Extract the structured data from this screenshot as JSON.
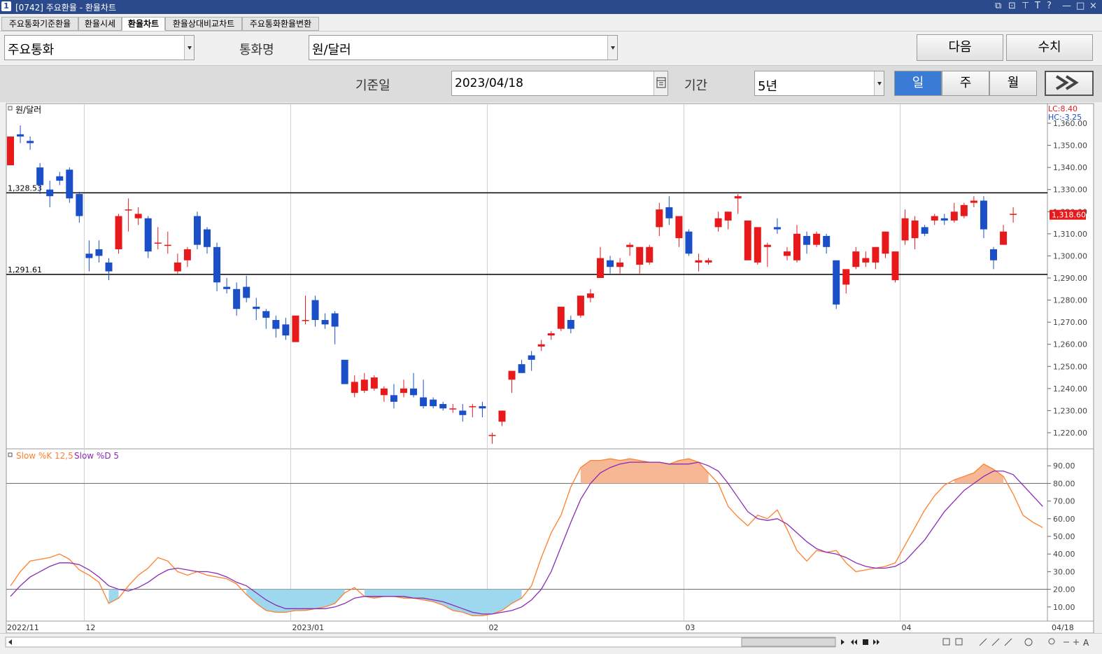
{
  "window": {
    "num": "1",
    "title": "[0742] 주요환율 - 환율차트",
    "controls": [
      "⧉",
      "⊡",
      "⊤",
      "T",
      "?",
      "—",
      "□",
      "×"
    ]
  },
  "tabs": [
    {
      "label": "주요통화기준환율",
      "active": false
    },
    {
      "label": "환율시세",
      "active": false
    },
    {
      "label": "환율차트",
      "active": true
    },
    {
      "label": "환율상대비교차트",
      "active": false
    },
    {
      "label": "주요통화환율변환",
      "active": false
    }
  ],
  "toolbar": {
    "group_value": "주요통화",
    "currency_label": "통화명",
    "currency_value": "원/달러",
    "next_label": "다음",
    "value_label": "수치"
  },
  "filter": {
    "date_label": "기준일",
    "date_value": "2023/04/18",
    "period_label": "기간",
    "period_value": "5년",
    "periods": [
      {
        "label": "일",
        "active": true
      },
      {
        "label": "주",
        "active": false
      },
      {
        "label": "월",
        "active": false
      }
    ],
    "expand_icon": "double-chevron-right-icon"
  },
  "colors": {
    "up": "#e8191b",
    "down": "#1a4fc8",
    "k_line": "#ff7f2a",
    "d_line": "#8a2bb5",
    "overbought_fill": "#f6b894",
    "oversold_fill": "#9dd8ef"
  },
  "chart_data": [
    {
      "type": "candlestick",
      "title": "원/달러",
      "legend_extra": [
        "LC:8.40",
        "HC:-3.25"
      ],
      "ylim": [
        1215,
        1360
      ],
      "yticks": [
        "1,360.00",
        "1,350.00",
        "1,340.00",
        "1,330.00",
        "1,320.00",
        "1,310.00",
        "1,300.00",
        "1,290.00",
        "1,280.00",
        "1,270.00",
        "1,260.00",
        "1,250.00",
        "1,240.00",
        "1,230.00",
        "1,220.00"
      ],
      "hlines": [
        {
          "value": 1328.53,
          "label": "1,328.53"
        },
        {
          "value": 1291.61,
          "label": "1,291.61"
        }
      ],
      "last_price_label": "1,318.60",
      "x_labels": [
        {
          "label": "2022/11",
          "index": 0
        },
        {
          "label": "12",
          "index": 8
        },
        {
          "label": "2023/01",
          "index": 29
        },
        {
          "label": "02",
          "index": 49
        },
        {
          "label": "03",
          "index": 69
        },
        {
          "label": "04",
          "index": 91
        },
        {
          "label": "04/18",
          "index": 103
        }
      ],
      "candles": [
        [
          1341,
          1354,
          1342,
          1354
        ],
        [
          1355,
          1359,
          1351,
          1354
        ],
        [
          1352,
          1354,
          1348,
          1351
        ],
        [
          1340,
          1342,
          1328,
          1332
        ],
        [
          1330,
          1334,
          1322,
          1327
        ],
        [
          1336,
          1338,
          1332,
          1334
        ],
        [
          1339,
          1340,
          1324,
          1326
        ],
        [
          1328,
          1329,
          1315,
          1318
        ],
        [
          1301,
          1307,
          1293,
          1299
        ],
        [
          1303,
          1307,
          1297,
          1300
        ],
        [
          1297,
          1299,
          1289,
          1293
        ],
        [
          1303,
          1319,
          1301,
          1318
        ],
        [
          1321,
          1326,
          1311,
          1321
        ],
        [
          1317,
          1322,
          1314,
          1319
        ],
        [
          1317,
          1318,
          1299,
          1302
        ],
        [
          1306,
          1313,
          1303,
          1306
        ],
        [
          1305,
          1311,
          1301,
          1305
        ],
        [
          1293,
          1301,
          1292,
          1297
        ],
        [
          1298,
          1304,
          1295,
          1303
        ],
        [
          1318,
          1320,
          1303,
          1305
        ],
        [
          1312,
          1313,
          1301,
          1304
        ],
        [
          1304,
          1306,
          1284,
          1288
        ],
        [
          1286,
          1290,
          1283,
          1285
        ],
        [
          1285,
          1288,
          1273,
          1276
        ],
        [
          1286,
          1291,
          1279,
          1281
        ],
        [
          1277,
          1281,
          1271,
          1276
        ],
        [
          1275,
          1276,
          1267,
          1272
        ],
        [
          1271,
          1273,
          1263,
          1267
        ],
        [
          1269,
          1272,
          1262,
          1264
        ],
        [
          1261,
          1273,
          1261,
          1273
        ],
        [
          1271,
          1282,
          1269,
          1271
        ],
        [
          1280,
          1282,
          1268,
          1271
        ],
        [
          1271,
          1274,
          1267,
          1269
        ],
        [
          1274,
          1275,
          1260,
          1268
        ],
        [
          1253,
          1253,
          1242,
          1242
        ],
        [
          1238,
          1246,
          1236,
          1243
        ],
        [
          1239,
          1247,
          1238,
          1244
        ],
        [
          1240,
          1246,
          1239,
          1245
        ],
        [
          1237,
          1241,
          1234,
          1240
        ],
        [
          1237,
          1242,
          1231,
          1234
        ],
        [
          1238,
          1244,
          1236,
          1240
        ],
        [
          1240,
          1247,
          1236,
          1237
        ],
        [
          1236,
          1244,
          1231,
          1232
        ],
        [
          1235,
          1236,
          1231,
          1232
        ],
        [
          1233,
          1234,
          1230,
          1231
        ],
        [
          1231,
          1233,
          1229,
          1231
        ],
        [
          1230,
          1233,
          1225,
          1228
        ],
        [
          1232,
          1233,
          1227,
          1232
        ],
        [
          1232,
          1234,
          1227,
          1231
        ],
        [
          1219,
          1220,
          1215,
          1219
        ],
        [
          1225,
          1230,
          1223,
          1230
        ],
        [
          1244,
          1245,
          1238,
          1248
        ],
        [
          1251,
          1253,
          1247,
          1247
        ],
        [
          1255,
          1257,
          1248,
          1253
        ],
        [
          1259,
          1262,
          1257,
          1260
        ],
        [
          1264,
          1266,
          1262,
          1265
        ],
        [
          1267,
          1277,
          1266,
          1277
        ],
        [
          1271,
          1273,
          1265,
          1267
        ],
        [
          1273,
          1282,
          1272,
          1282
        ],
        [
          1281,
          1285,
          1279,
          1283
        ],
        [
          1290,
          1304,
          1290,
          1299
        ],
        [
          1298,
          1300,
          1292,
          1295
        ],
        [
          1295,
          1299,
          1292,
          1297
        ],
        [
          1304,
          1306,
          1300,
          1305
        ],
        [
          1296,
          1303,
          1292,
          1304
        ],
        [
          1297,
          1305,
          1296,
          1304
        ],
        [
          1313,
          1324,
          1309,
          1321
        ],
        [
          1322,
          1327,
          1314,
          1317
        ],
        [
          1308,
          1315,
          1304,
          1318
        ],
        [
          1311,
          1312,
          1300,
          1301
        ],
        [
          1297,
          1301,
          1293,
          1298
        ],
        [
          1297,
          1299,
          1296,
          1298
        ],
        [
          1313,
          1320,
          1311,
          1317
        ],
        [
          1316,
          1317,
          1312,
          1320
        ],
        [
          1326,
          1328,
          1319,
          1327
        ],
        [
          1298,
          1316,
          1298,
          1316
        ],
        [
          1297,
          1313,
          1296,
          1313
        ],
        [
          1304,
          1306,
          1295,
          1305
        ],
        [
          1313,
          1317,
          1310,
          1312
        ],
        [
          1300,
          1304,
          1298,
          1302
        ],
        [
          1298,
          1314,
          1297,
          1310
        ],
        [
          1309,
          1311,
          1301,
          1305
        ],
        [
          1305,
          1311,
          1304,
          1310
        ],
        [
          1309,
          1310,
          1301,
          1304
        ],
        [
          1298,
          1298,
          1276,
          1278
        ],
        [
          1287,
          1294,
          1283,
          1294
        ],
        [
          1295,
          1304,
          1294,
          1302
        ],
        [
          1297,
          1302,
          1295,
          1299
        ],
        [
          1297,
          1304,
          1294,
          1304
        ],
        [
          1301,
          1311,
          1299,
          1311
        ],
        [
          1289,
          1301,
          1288,
          1302
        ],
        [
          1307,
          1321,
          1305,
          1317
        ],
        [
          1308,
          1318,
          1303,
          1316
        ],
        [
          1313,
          1314,
          1309,
          1310
        ],
        [
          1316,
          1319,
          1314,
          1318
        ],
        [
          1317,
          1319,
          1314,
          1316
        ],
        [
          1316,
          1324,
          1315,
          1320
        ],
        [
          1318,
          1324,
          1317,
          1323
        ],
        [
          1324,
          1327,
          1322,
          1325
        ],
        [
          1325,
          1327,
          1308,
          1312
        ],
        [
          1303,
          1304,
          1294,
          1298
        ],
        [
          1305,
          1314,
          1305,
          1311
        ],
        [
          1319,
          1322,
          1315,
          1319
        ]
      ]
    },
    {
      "type": "line",
      "legend": [
        {
          "name": "Slow %K 12,5",
          "color": "#ff7f2a"
        },
        {
          "name": "Slow %D 5",
          "color": "#8a2bb5"
        }
      ],
      "ylim": [
        0,
        100
      ],
      "yticks": [
        "90.00",
        "80.00",
        "70.00",
        "60.00",
        "50.00",
        "40.00",
        "30.00",
        "20.00",
        "10.00"
      ],
      "bands": [
        20,
        80
      ],
      "series": [
        {
          "name": "Slow %K 12,5",
          "values": [
            22,
            30,
            36,
            37,
            38,
            40,
            37,
            31,
            28,
            24,
            12,
            15,
            22,
            28,
            32,
            38,
            36,
            30,
            28,
            30,
            28,
            27,
            26,
            23,
            17,
            12,
            8,
            7,
            7,
            8,
            8,
            9,
            10,
            12,
            18,
            21,
            16,
            15,
            16,
            16,
            15,
            15,
            14,
            13,
            11,
            8,
            7,
            5,
            5,
            6,
            8,
            12,
            15,
            22,
            38,
            52,
            62,
            78,
            89,
            93,
            93,
            94,
            93,
            94,
            93,
            92,
            92,
            91,
            93,
            94,
            92,
            86,
            80,
            67,
            61,
            56,
            62,
            60,
            65,
            54,
            42,
            36,
            42,
            41,
            42,
            35,
            30,
            31,
            32,
            33,
            35,
            45,
            55,
            65,
            73,
            79,
            82,
            84,
            86,
            91,
            88,
            84,
            74,
            62,
            58,
            55
          ]
        },
        {
          "name": "Slow %D 5",
          "values": [
            16,
            22,
            27,
            30,
            33,
            35,
            35,
            34,
            31,
            27,
            22,
            20,
            19,
            21,
            24,
            28,
            31,
            32,
            31,
            30,
            30,
            29,
            27,
            24,
            22,
            18,
            14,
            11,
            9,
            9,
            9,
            9,
            9,
            10,
            12,
            15,
            16,
            16,
            16,
            16,
            16,
            15,
            15,
            14,
            13,
            11,
            9,
            7,
            6,
            6,
            7,
            8,
            10,
            14,
            20,
            30,
            44,
            58,
            71,
            80,
            86,
            89,
            91,
            92,
            92,
            92,
            92,
            91,
            91,
            91,
            92,
            90,
            87,
            80,
            72,
            64,
            60,
            59,
            60,
            57,
            52,
            47,
            43,
            41,
            40,
            38,
            35,
            33,
            32,
            32,
            33,
            36,
            42,
            48,
            56,
            64,
            70,
            76,
            80,
            84,
            87,
            87,
            85,
            79,
            73,
            67
          ]
        }
      ]
    }
  ],
  "bottombar": {
    "nav_icons": [
      "left-icon",
      "right-icon",
      "prev-icon",
      "stop-icon",
      "next-icon"
    ]
  }
}
